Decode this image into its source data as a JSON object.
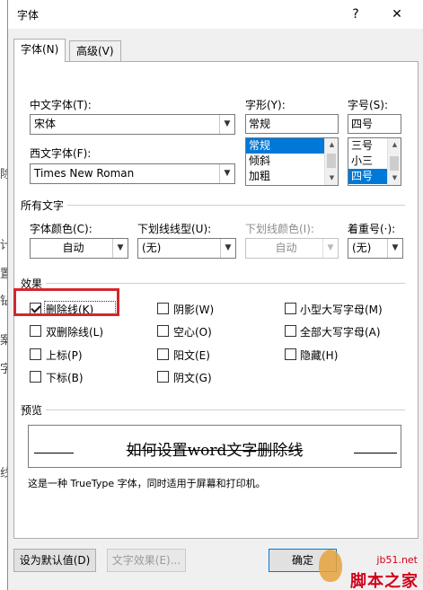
{
  "dialog": {
    "title": "字体",
    "help_glyph": "?",
    "close_glyph": "✕"
  },
  "tabs": [
    "字体(N)",
    "高级(V)"
  ],
  "fonts": {
    "chinese_font_label": "中文字体(T):",
    "chinese_font_value": "宋体",
    "western_font_label": "西文字体(F):",
    "western_font_value": "Times New Roman",
    "style_label": "字形(Y):",
    "style_value": "常规",
    "style_options": [
      "常规",
      "倾斜",
      "加粗"
    ],
    "style_selected": "常规",
    "size_label": "字号(S):",
    "size_value": "四号",
    "size_options": [
      "三号",
      "小三",
      "四号"
    ],
    "size_selected": "四号"
  },
  "all_text": {
    "section_label": "所有文字",
    "font_color_label": "字体颜色(C):",
    "font_color_value": "自动",
    "underline_style_label": "下划线线型(U):",
    "underline_style_value": "(无)",
    "underline_color_label": "下划线颜色(I):",
    "underline_color_value": "自动",
    "emphasis_label": "着重号(·):",
    "emphasis_value": "(无)"
  },
  "effects": {
    "section_label": "效果",
    "items": [
      {
        "label": "删除线(K)",
        "checked": true
      },
      {
        "label": "阴影(W)",
        "checked": false
      },
      {
        "label": "小型大写字母(M)",
        "checked": false
      },
      {
        "label": "双删除线(L)",
        "checked": false
      },
      {
        "label": "空心(O)",
        "checked": false
      },
      {
        "label": "全部大写字母(A)",
        "checked": false
      },
      {
        "label": "上标(P)",
        "checked": false
      },
      {
        "label": "阳文(E)",
        "checked": false
      },
      {
        "label": "隐藏(H)",
        "checked": false
      },
      {
        "label": "下标(B)",
        "checked": false
      },
      {
        "label": "阴文(G)",
        "checked": false
      }
    ]
  },
  "preview": {
    "section_label": "预览",
    "sample_text": "如何设置word文字删除线",
    "note": "这是一种 TrueType 字体，同时适用于屏幕和打印机。"
  },
  "buttons": {
    "set_default": "设为默认值(D)",
    "text_effects": "文字效果(E)...",
    "ok": "确定"
  },
  "watermark": {
    "site": "jb51.net",
    "brand": "脚本之家"
  },
  "background_doc": {
    "fragments": [
      "除",
      "计",
      "置",
      "钻",
      "案",
      "字",
      "线"
    ]
  },
  "colors": {
    "selection": "#0078d7",
    "highlight_box": "#d4272b",
    "dialog_bg": "#f0f0f0"
  }
}
